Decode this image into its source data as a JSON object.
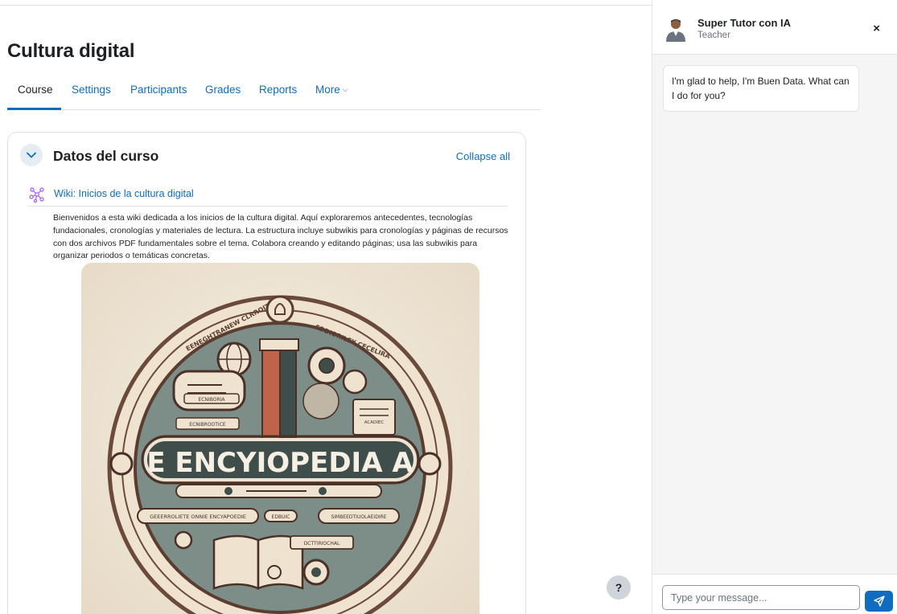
{
  "course": {
    "title": "Cultura digital",
    "tabs": [
      {
        "label": "Course",
        "active": true
      },
      {
        "label": "Settings"
      },
      {
        "label": "Participants"
      },
      {
        "label": "Grades"
      },
      {
        "label": "Reports"
      },
      {
        "label": "More"
      }
    ]
  },
  "section": {
    "title": "Datos del curso",
    "collapse_all_label": "Collapse all"
  },
  "activity": {
    "link_label": "Wiki: Inicios de la cultura digital",
    "icon": "wiki-icon",
    "description": "Bienvenidos a esta wiki dedicada a los inicios de la cultura digital. Aquí exploraremos antecedentes, tecnologías fundacionales, cronologías y materiales de lectura. La estructura incluye subwikis para cronologías y páginas de recursos con dos archivos PDF fundamentales sobre el tema. Colabora creando y editando páginas; usa las subwikis para organizar periodos o temáticas concretas.",
    "image": {
      "banner_text": "E ENCYIOPEDIA  A",
      "labels": [
        "ECNIBORIA",
        "ECNIBROOTICE",
        "ACADIEC",
        "GEEERROLIETE ONNIE ENCYAPOEDIE",
        "EDBUIC",
        "SIMBEEDTIUOLAEIDIRE",
        "DCTTIRIOCHAL"
      ],
      "ring_text_left": "EENEGHTRANEW CLRROITONIE",
      "ring_text_right": "EDDIORILEY CECELIRA"
    }
  },
  "help": {
    "label": "?"
  },
  "chat": {
    "tutor_name": "Super Tutor con IA",
    "tutor_role": "Teacher",
    "close_label": "×",
    "message": "I'm glad to help, I'm Buen Data. What can I do for you?",
    "input_placeholder": "Type your message..."
  },
  "colors": {
    "link": "#0f6cbf",
    "text": "#1d2125",
    "border": "#dee2e6",
    "drawer_bg": "#f5f5f5"
  }
}
